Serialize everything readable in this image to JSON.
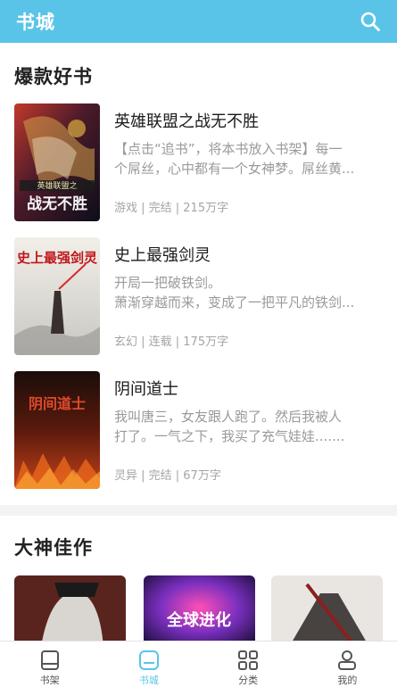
{
  "header": {
    "title": "书城",
    "icon": "search-icon"
  },
  "sections": [
    {
      "title": "爆款好书"
    },
    {
      "title": "大神佳作"
    }
  ],
  "books": [
    {
      "name": "英雄联盟之战无不胜",
      "desc_line1": "【点击“追书”，将本书放入书架】每一",
      "desc_line2": "个屌丝，心中都有一个女神梦。屌丝黄...",
      "meta": "游戏 | 完结 | 215万字",
      "cover_text_top": "英雄联盟之",
      "cover_text_main": "战无不胜"
    },
    {
      "name": "史上最强剑灵",
      "desc_line1": "开局一把破铁剑。",
      "desc_line2": "萧渐穿越而来，变成了一把平凡的铁剑...",
      "meta": "玄幻 | 连载 | 175万字",
      "cover_text_main": "史上最强剑灵"
    },
    {
      "name": "阴间道士",
      "desc_line1": "我叫唐三，女友跟人跑了。然后我被人",
      "desc_line2": "打了。一气之下，我买了充气娃娃.......",
      "meta": "灵异 | 完结 | 67万字",
      "cover_text_main": "阴间道士"
    }
  ],
  "featured": [
    {
      "cover_text": ""
    },
    {
      "cover_text": "全球进化"
    },
    {
      "cover_text": ""
    }
  ],
  "tabs": [
    {
      "label": "书架",
      "icon": "bookshelf-icon",
      "active": false
    },
    {
      "label": "书城",
      "icon": "bookstore-icon",
      "active": true
    },
    {
      "label": "分类",
      "icon": "category-grid-icon",
      "active": false
    },
    {
      "label": "我的",
      "icon": "profile-icon",
      "active": false
    }
  ],
  "colors": {
    "accent": "#5ac4e8",
    "text_primary": "#1a1a1a",
    "text_secondary": "#9a9a9a"
  }
}
